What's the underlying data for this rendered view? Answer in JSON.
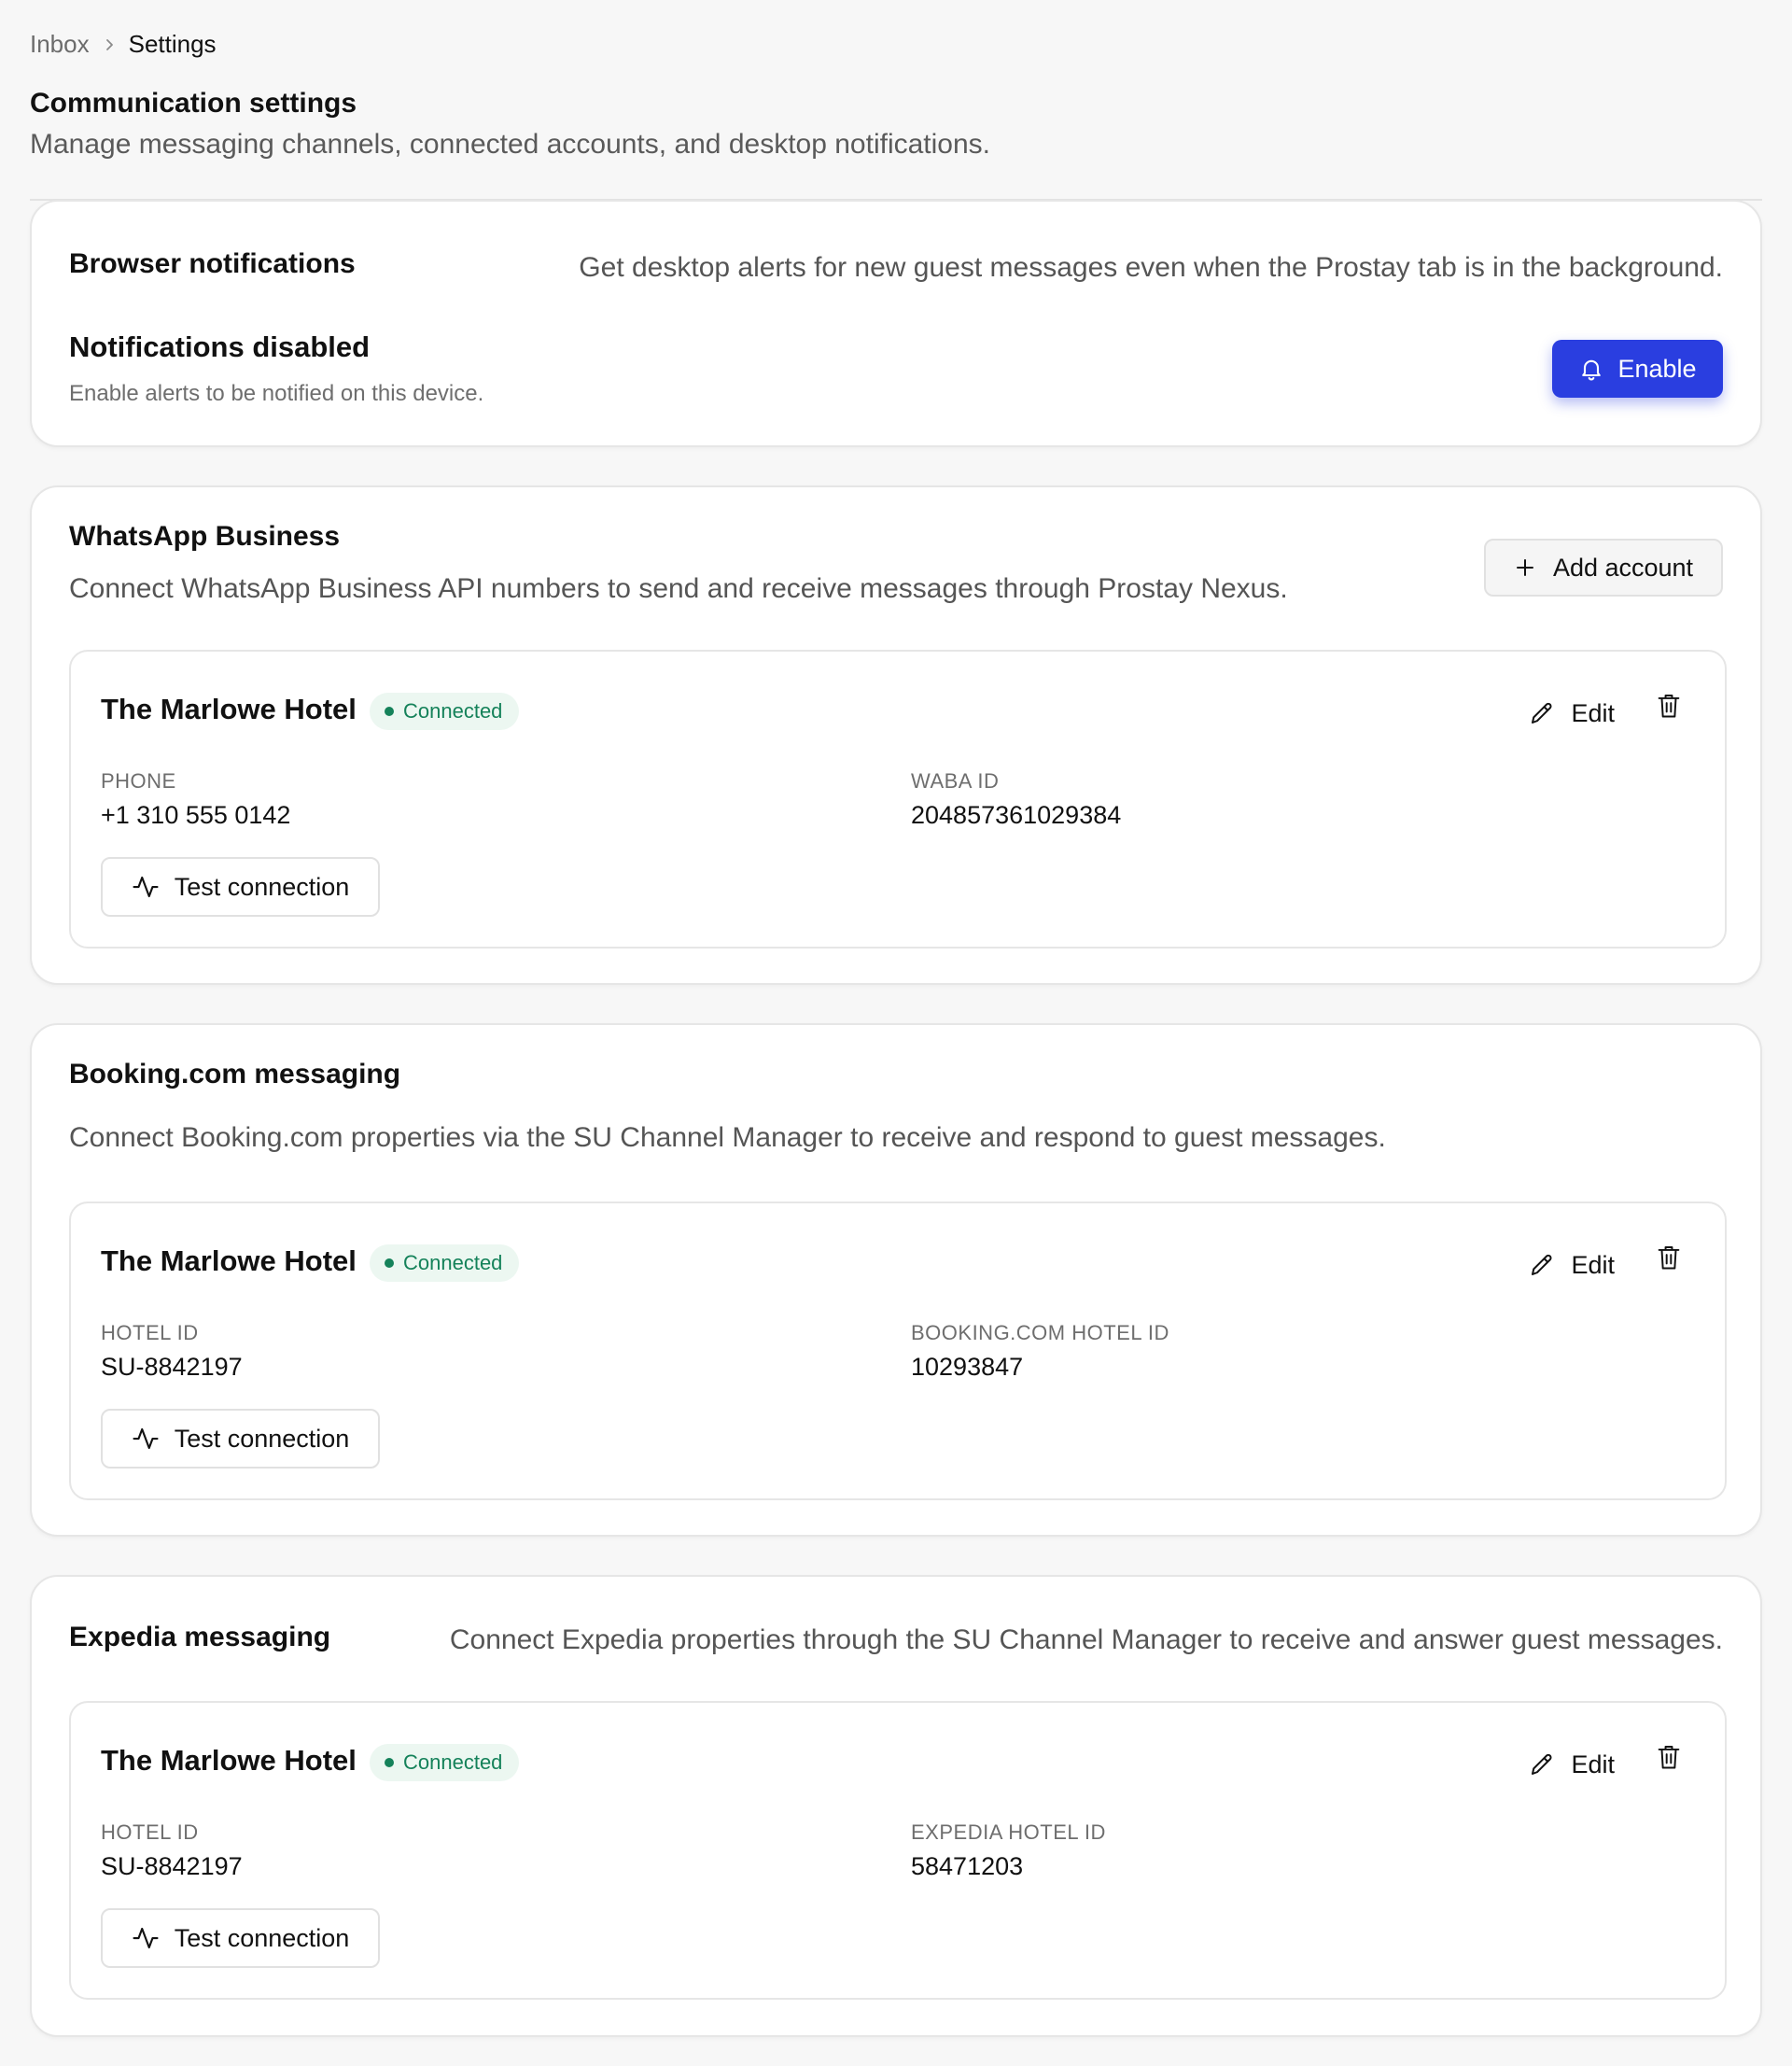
{
  "breadcrumb": {
    "root": "Inbox",
    "current": "Settings"
  },
  "page": {
    "title": "Communication settings",
    "subtitle": "Manage messaging channels, connected accounts, and desktop notifications."
  },
  "browser_notifications": {
    "title": "Browser notifications",
    "description": "Get desktop alerts for new guest messages even when the Prostay tab is in the background.",
    "status_title": "Notifications disabled",
    "status_subtitle": "Enable alerts to be notified on this device.",
    "enable_label": "Enable",
    "enable_icon": "bell-icon",
    "accent_color": "#2a3ee0"
  },
  "whatsapp": {
    "title": "WhatsApp Business",
    "description": "Connect WhatsApp Business API numbers to send and receive messages through Prostay Nexus.",
    "add_label": "Add account",
    "account": {
      "name": "The Marlowe Hotel",
      "status": "Connected",
      "field_a_label": "PHONE",
      "field_a_value": "+1 310 555 0142",
      "field_b_label": "WABA ID",
      "field_b_value": "204857361029384",
      "edit_label": "Edit",
      "test_label": "Test connection"
    }
  },
  "booking": {
    "title": "Booking.com messaging",
    "description": "Connect Booking.com properties via the SU Channel Manager to receive and respond to guest messages.",
    "account": {
      "name": "The Marlowe Hotel",
      "status": "Connected",
      "field_a_label": "HOTEL ID",
      "field_a_value": "SU-8842197",
      "field_b_label": "BOOKING.COM HOTEL ID",
      "field_b_value": "10293847",
      "edit_label": "Edit",
      "test_label": "Test connection"
    }
  },
  "expedia": {
    "title": "Expedia messaging",
    "description": "Connect Expedia properties through the SU Channel Manager to receive and answer guest messages.",
    "account": {
      "name": "The Marlowe Hotel",
      "status": "Connected",
      "field_a_label": "HOTEL ID",
      "field_a_value": "SU-8842197",
      "field_b_label": "EXPEDIA HOTEL ID",
      "field_b_value": "58471203",
      "edit_label": "Edit",
      "test_label": "Test connection"
    }
  },
  "colors": {
    "status_connected": "#15825a",
    "status_bg": "#ecf7f1"
  }
}
